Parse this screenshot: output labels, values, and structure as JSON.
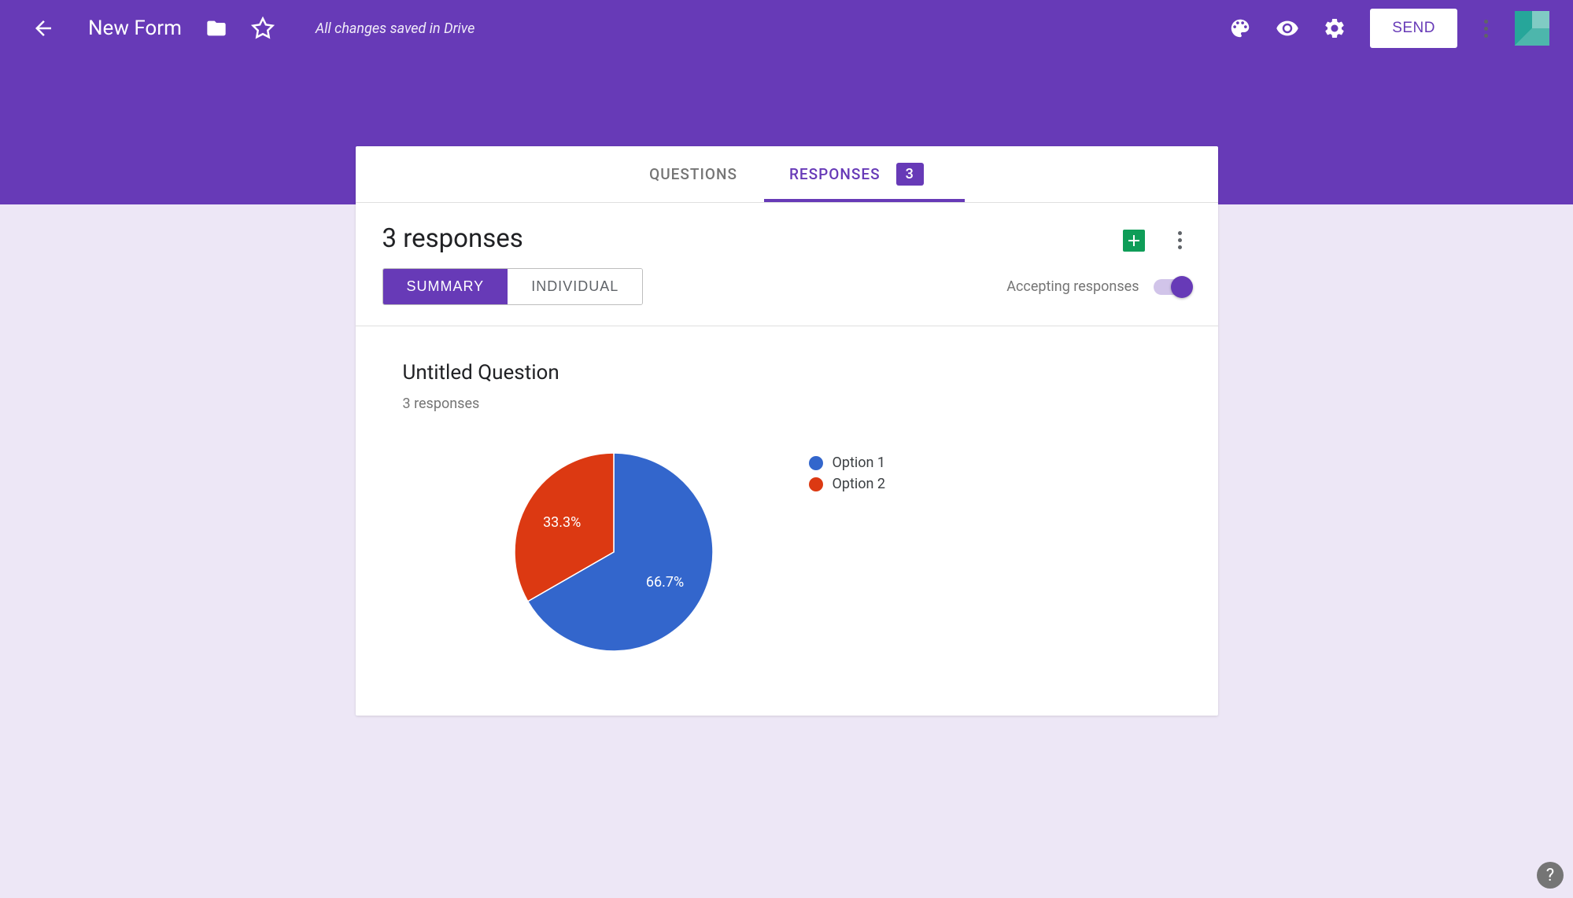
{
  "header": {
    "title": "New Form",
    "save_status": "All changes saved in Drive",
    "send_label": "SEND"
  },
  "tabs": {
    "questions": "QUESTIONS",
    "responses": "RESPONSES",
    "responses_count": "3"
  },
  "responses": {
    "title": "3 responses",
    "summary_label": "SUMMARY",
    "individual_label": "INDIVIDUAL",
    "accepting_label": "Accepting responses",
    "accepting_on": true
  },
  "question": {
    "title": "Untitled Question",
    "count_label": "3 responses"
  },
  "chart_data": {
    "type": "pie",
    "title": "Untitled Question",
    "series": [
      {
        "name": "Option 1",
        "value": 66.7,
        "label": "66.7%",
        "color": "#3366cc"
      },
      {
        "name": "Option 2",
        "value": 33.3,
        "label": "33.3%",
        "color": "#dc3912"
      }
    ]
  },
  "colors": {
    "primary": "#673ab7",
    "blue": "#3366cc",
    "red": "#dc3912"
  }
}
